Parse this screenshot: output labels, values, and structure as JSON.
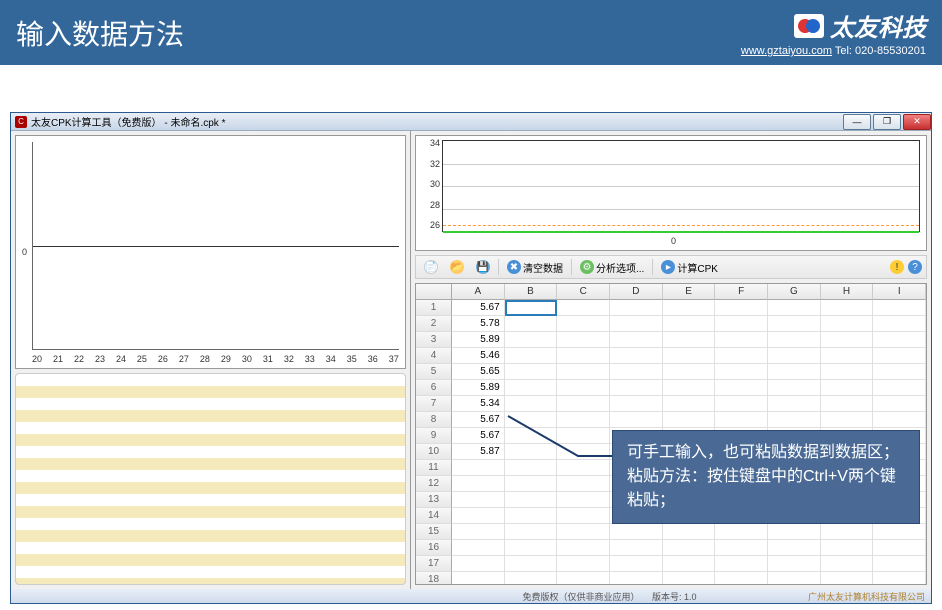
{
  "header": {
    "title": "输入数据方法",
    "company": "太友科技",
    "website": "www.gztaiyou.com",
    "tel_label": "Tel:",
    "tel": "020-85530201"
  },
  "window": {
    "title": "太友CPK计算工具（免费版） - 未命名.cpk *"
  },
  "toolbar": {
    "new": "新建",
    "open": "打开",
    "save": "保存",
    "clear": "清空数据",
    "options": "分析选项...",
    "calc": "计算CPK"
  },
  "chart_data": {
    "left_chart": {
      "type": "line",
      "x_ticks": [
        "20",
        "21",
        "22",
        "23",
        "24",
        "25",
        "26",
        "27",
        "28",
        "29",
        "30",
        "31",
        "32",
        "33",
        "34",
        "35",
        "36",
        "37"
      ],
      "y_zero": "0",
      "series": []
    },
    "top_chart": {
      "type": "line",
      "y_ticks": [
        "34",
        "32",
        "30",
        "28",
        "26"
      ],
      "x_zero": "0",
      "green_line_y": 26,
      "orange_line_y": 26.5,
      "ylim": [
        26,
        34
      ]
    }
  },
  "grid": {
    "columns": [
      "A",
      "B",
      "C",
      "D",
      "E",
      "F",
      "G",
      "H",
      "I"
    ],
    "row_count": 18,
    "data": {
      "A": [
        "5.67",
        "5.78",
        "5.89",
        "5.46",
        "5.65",
        "5.89",
        "5.34",
        "5.67",
        "5.67",
        "5.87"
      ]
    },
    "selected_cell": {
      "row": 1,
      "col": "B"
    }
  },
  "statusbar": {
    "copyright": "免费版权（仅供非商业应用）",
    "version_label": "版本号:",
    "version": "1.0",
    "company_footer": "广州太友计算机科技有限公司"
  },
  "callout": {
    "line1": "可手工输入，也可粘贴数据到数据区；",
    "line2": "粘贴方法：按住键盘中的Ctrl+V两个键粘贴；"
  }
}
